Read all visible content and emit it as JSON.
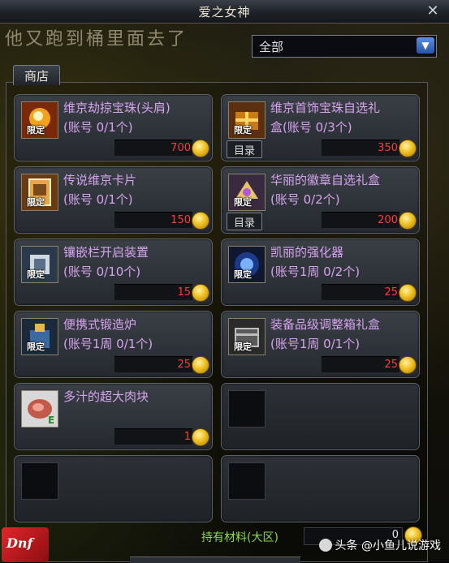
{
  "window": {
    "title": "爱之女神",
    "close_glyph": "✕"
  },
  "background_text": "他又跑到桶里面去了",
  "filter": {
    "selected": "全部",
    "arrow_glyph": "▼"
  },
  "tabs": [
    {
      "label": "商店"
    }
  ],
  "items": [
    {
      "name": "维京劫掠宝珠(头肩)",
      "limit": "(账号 0/1个)",
      "price": "700",
      "badge": "限定",
      "has_catalog": false,
      "icon": "orb-icon"
    },
    {
      "name": "维京首饰宝珠自选礼",
      "name2": "盒(账号 0/3个)",
      "limit": "",
      "price": "350",
      "badge": "限定",
      "has_catalog": true,
      "catalog_label": "目录",
      "icon": "gift-box-icon"
    },
    {
      "name": "传说维京卡片",
      "limit": "(账号 0/1个)",
      "price": "150",
      "badge": "限定",
      "has_catalog": false,
      "icon": "card-icon"
    },
    {
      "name": "华丽的徽章自选礼盒",
      "limit": "(账号 0/2个)",
      "price": "200",
      "badge": "限定",
      "has_catalog": true,
      "catalog_label": "目录",
      "icon": "emblem-box-icon"
    },
    {
      "name": "镶嵌栏开启装置",
      "limit": "(账号 0/10个)",
      "price": "15",
      "badge": "限定",
      "has_catalog": false,
      "icon": "socket-device-icon"
    },
    {
      "name": "凯丽的强化器",
      "limit": "(账号1周 0/2个)",
      "price": "25",
      "badge": "限定",
      "has_catalog": false,
      "icon": "reinforcer-icon"
    },
    {
      "name": "便携式锻造炉",
      "limit": "(账号1周 0/1个)",
      "price": "25",
      "badge": "限定",
      "has_catalog": false,
      "icon": "forge-icon"
    },
    {
      "name": "装备品级调整箱礼盒",
      "limit": "(账号1周 0/1个)",
      "price": "25",
      "badge": "限定",
      "has_catalog": false,
      "icon": "grade-box-icon"
    },
    {
      "name": "多汁的超大肉块",
      "limit": "",
      "price": "1",
      "badge": "",
      "has_catalog": false,
      "icon": "meat-icon"
    }
  ],
  "materials": {
    "label": "持有材料(大区)",
    "value": "0"
  },
  "logo_text": "Dnf",
  "watermark": "头条 @小鱼儿说游戏",
  "colors": {
    "item_name": "#d6a3ee",
    "price": "#ff3b3b",
    "material_label": "#8fdc3f"
  }
}
